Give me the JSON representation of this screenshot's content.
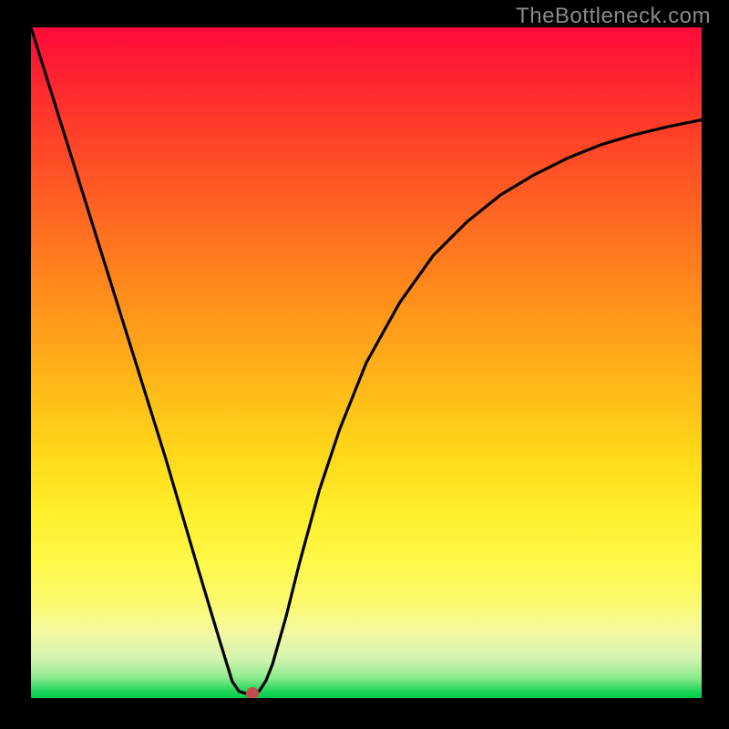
{
  "watermark": "TheBottleneck.com",
  "chart_data": {
    "type": "line",
    "title": "",
    "xlabel": "",
    "ylabel": "",
    "xlim": [
      0,
      100
    ],
    "ylim": [
      0,
      100
    ],
    "grid": false,
    "series": [
      {
        "name": "bottleneck-curve",
        "x": [
          0,
          5,
          10,
          15,
          20,
          25,
          28,
          30,
          31,
          32,
          33,
          34,
          35,
          36,
          38,
          40,
          43,
          46,
          50,
          55,
          60,
          65,
          70,
          75,
          80,
          85,
          90,
          95,
          100
        ],
        "values": [
          100,
          84,
          68,
          52,
          36,
          19,
          9,
          2.5,
          1,
          0.7,
          0.7,
          1,
          2.5,
          5,
          12,
          20,
          31,
          40,
          50,
          59,
          66,
          71,
          75,
          78,
          80.5,
          82.5,
          84,
          85.2,
          86.2
        ]
      }
    ],
    "annotations": [
      {
        "name": "min-marker",
        "x": 33,
        "y": 0.7,
        "color": "#c1504d"
      }
    ],
    "background_gradient": {
      "top": "#ff0b3a",
      "mid": "#ffd91a",
      "bottom": "#00c94e"
    }
  }
}
